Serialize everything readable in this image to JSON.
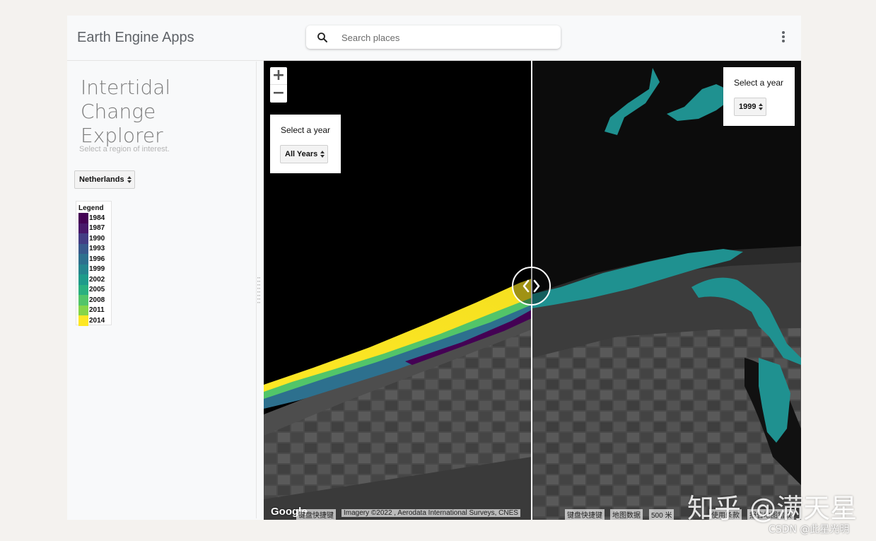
{
  "header": {
    "app_title": "Earth Engine Apps",
    "search_placeholder": "Search places"
  },
  "sidebar": {
    "title": "Intertidal Change Explorer",
    "hint": "Select a region of interest.",
    "region_selected": "Netherlands",
    "legend": {
      "title": "Legend",
      "items": [
        {
          "label": "1984",
          "color": "#440154"
        },
        {
          "label": "1987",
          "color": "#48186a"
        },
        {
          "label": "1990",
          "color": "#433d84"
        },
        {
          "label": "1993",
          "color": "#38598c"
        },
        {
          "label": "1996",
          "color": "#2d708e"
        },
        {
          "label": "1999",
          "color": "#25858e"
        },
        {
          "label": "2002",
          "color": "#1e9b8a"
        },
        {
          "label": "2005",
          "color": "#2ab07f"
        },
        {
          "label": "2008",
          "color": "#52c569"
        },
        {
          "label": "2011",
          "color": "#86d549"
        },
        {
          "label": "2014",
          "color": "#fde725"
        }
      ]
    }
  },
  "map": {
    "left_panel": {
      "label": "Select a year",
      "selected": "All Years"
    },
    "right_panel": {
      "label": "Select a year",
      "selected": "1999"
    },
    "zoom_in": "+",
    "zoom_out": "−",
    "google": "Google",
    "attribution_left": [
      "键盘快捷键",
      "Imagery ©2022 , Aerodata International Surveys, CNES"
    ],
    "attribution_right": [
      "键盘快捷键",
      "地图数据",
      "500 米",
      "使用条款",
      "报告地图错误"
    ]
  },
  "watermark": "知乎 @满天星",
  "csdn": "CSDN @此星光明",
  "colors": {
    "water_1999": "#1f9190",
    "yellow_2014": "#fde725"
  }
}
